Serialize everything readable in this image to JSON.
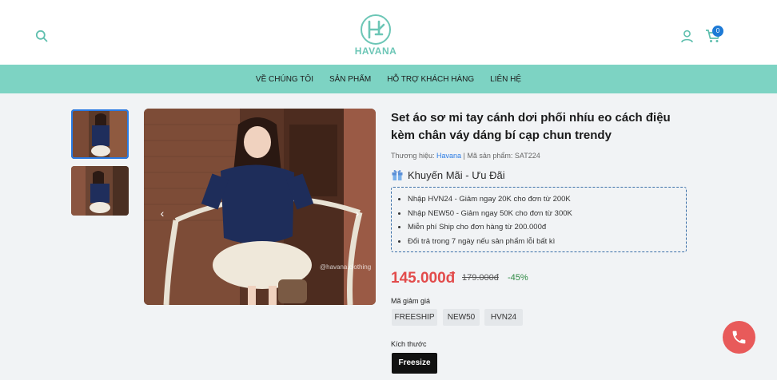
{
  "header": {
    "logo_text": "HAVANA",
    "cart_count": "0",
    "icons": [
      "search-icon",
      "logo-icon",
      "user-icon",
      "cart-icon"
    ]
  },
  "nav": {
    "items": [
      "VỀ CHÚNG TÔI",
      "SẢN PHẨM",
      "HỖ TRỢ KHÁCH HÀNG",
      "LIÊN HỆ"
    ]
  },
  "gallery": {
    "watermark": "@havana.clothing",
    "prev_arrow": "‹",
    "next_arrow": "›"
  },
  "product": {
    "title": "Set áo sơ mi tay cánh dơi phối nhíu eo cách điệu kèm chân váy dáng bí cạp chun trendy",
    "brand_label": "Thương hiệu:",
    "brand": "Havana",
    "sku_label": "| Mã sản phẩm: SAT224",
    "promo_title": "Khuyến Mãi - Ưu Đãi",
    "promos": [
      "Nhập HVN24 - Giảm ngay 20K cho đơn từ 200K",
      "Nhập NEW50 - Giảm ngay 50K cho đơn từ 300K",
      "Miễn phí Ship cho đơn hàng từ 200.000đ",
      "Đổi trả trong 7 ngày nếu sản phẩm lỗi bất kì"
    ],
    "price": "145.000đ",
    "old_price": "179.000đ",
    "discount": "-45%",
    "coupon_label": "Mã giảm giá",
    "coupons": [
      "FREESHIP",
      "NEW50",
      "HVN24"
    ],
    "size_label": "Kích thước",
    "size": "Freesize"
  },
  "colors": {
    "accent": "#7dd3c3",
    "logo": "#6cc6b6",
    "price": "#e24b4b",
    "call": "#e85a5a"
  }
}
